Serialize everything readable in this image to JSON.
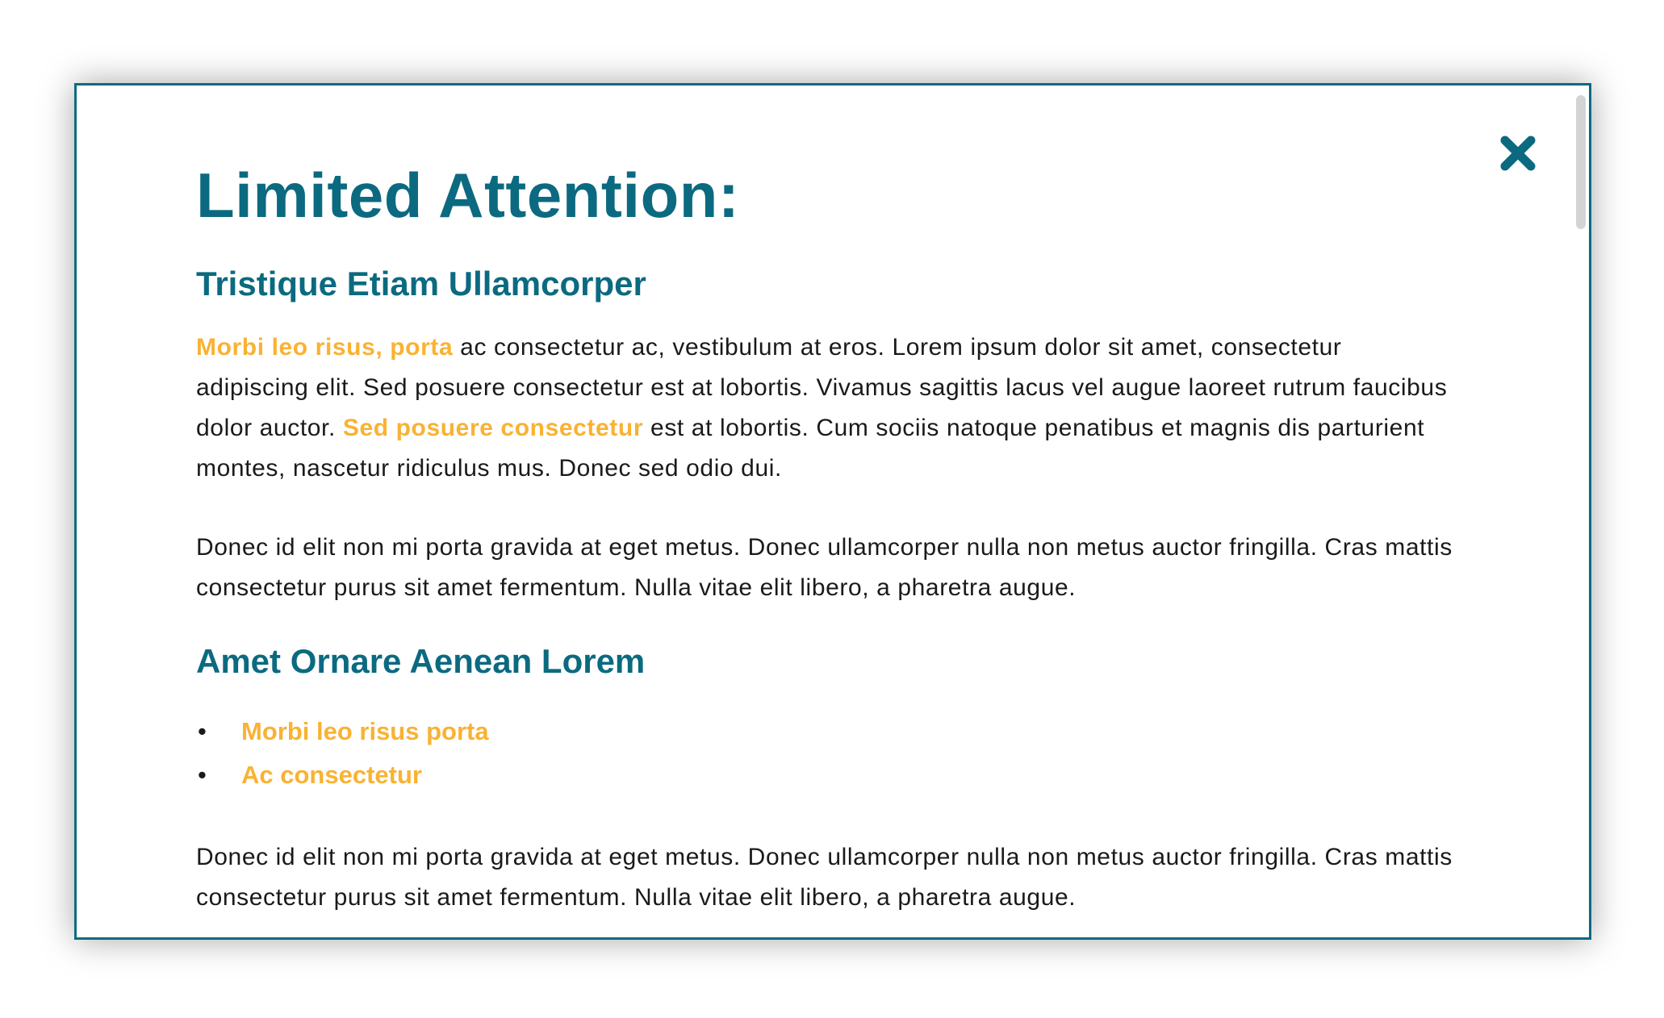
{
  "dialog": {
    "title": "Limited Attention:",
    "close_icon": "close-icon",
    "colors": {
      "accent": "#0b6a80",
      "highlight": "#f9b233",
      "text": "#1a1a1a"
    },
    "section1": {
      "heading": "Tristique Etiam Ullamcorper",
      "p1_hl1": "Morbi leo risus, porta",
      "p1_t1": " ac consectetur ac, vestibulum at eros. Lorem ipsum dolor sit amet, consectetur adipiscing elit. Sed posuere consectetur est at lobortis. Vivamus sagittis lacus vel augue laoreet rutrum faucibus dolor auctor. ",
      "p1_hl2": "Sed posuere consectetur",
      "p1_t2": " est at lobortis. Cum sociis natoque penatibus et magnis dis parturient montes, nascetur ridiculus mus. Donec sed odio dui.",
      "p2": "Donec id elit non mi porta gravida at eget metus. Donec ullamcorper nulla non metus auctor fringilla. Cras mattis consectetur purus sit amet fermentum. Nulla vitae elit libero, a pharetra augue."
    },
    "section2": {
      "heading": "Amet Ornare Aenean Lorem",
      "bullet": "•",
      "list": [
        "Morbi leo risus porta",
        "Ac consectetur"
      ],
      "p3": "Donec id elit non mi porta gravida at eget metus. Donec ullamcorper nulla non metus auctor fringilla. Cras mattis consectetur purus sit amet fermentum. Nulla vitae elit libero, a pharetra augue."
    }
  }
}
